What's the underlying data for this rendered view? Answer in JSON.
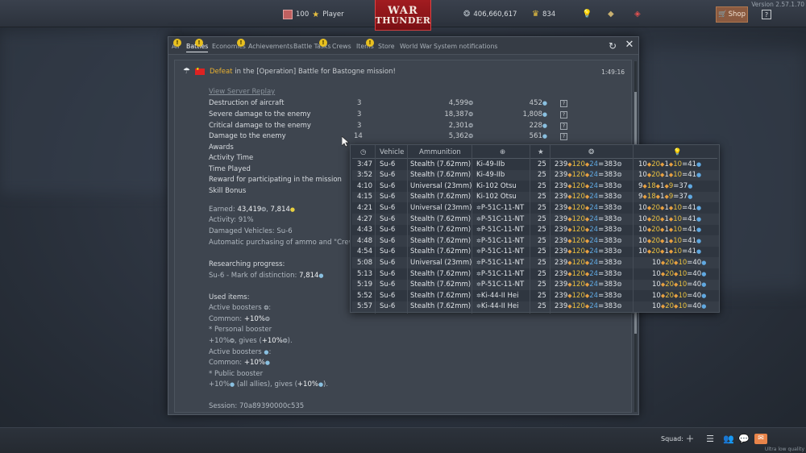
{
  "version": "Version 2.57.1.70",
  "topbar": {
    "player_level": "100",
    "player_name": "Player",
    "logo_line1": "WAR",
    "logo_line2": "THUNDER",
    "silver_lions": "406,660,617",
    "golden_eagles": "834",
    "shop_label": "Shop",
    "help_label": "?"
  },
  "window": {
    "tabs": [
      {
        "label": "All",
        "badge": "!"
      },
      {
        "label": "Battles",
        "badge": "!",
        "active": true
      },
      {
        "label": "Economics",
        "badge": "!"
      },
      {
        "label": "Achievements"
      },
      {
        "label": "Battle Tasks",
        "badge": "!"
      },
      {
        "label": "Crews"
      },
      {
        "label": "Items",
        "badge": "!"
      },
      {
        "label": "Store"
      },
      {
        "label": "World War"
      },
      {
        "label": "System notifications"
      }
    ],
    "refresh_icon": "↻",
    "close_icon": "✕"
  },
  "message": {
    "defeat_word": "Defeat",
    "title_rest": " in the [Operation] Battle for Bastogne mission!",
    "time": "1:49:16",
    "replay_link": "View Server Replay",
    "stats": [
      {
        "label": "Destruction of aircraft",
        "count": "3",
        "sl": "4,599",
        "rp": "452"
      },
      {
        "label": "Severe damage to the enemy",
        "count": "3",
        "sl": "18,387",
        "rp": "1,808"
      },
      {
        "label": "Critical damage to the enemy",
        "count": "3",
        "sl": "2,301",
        "rp": "228"
      },
      {
        "label": "Damage to the enemy",
        "count": "14",
        "sl": "5,362",
        "rp": "561"
      },
      {
        "label": "Awards"
      },
      {
        "label": "Activity Time"
      },
      {
        "label": "Time Played"
      },
      {
        "label": "Reward for participating in the mission"
      },
      {
        "label": "Skill Bonus"
      }
    ],
    "earned_label": "Earned: ",
    "earned_sl": "43,419",
    "earned_rp": "7,814",
    "activity": "Activity: 91%",
    "damaged_vehicles": "Damaged Vehicles: Su-6",
    "auto_purchase": "Automatic purchasing of ammo and \"Crew R",
    "researching_label": "Researching progress:",
    "research_item": "Su-6 - Mark of distinction: ",
    "research_rp": "7,814",
    "used_items_label": "Used items:",
    "active_boosters_sl": "Active boosters ",
    "common_sl_label": "Common: ",
    "common_sl_val": "+10%",
    "personal_booster": "* Personal booster",
    "personal_gives_a": "+10%",
    "personal_gives_b": ", gives (",
    "personal_gives_c": "+10%",
    "personal_gives_d": ").",
    "active_boosters_rp": "Active boosters ",
    "common_rp_label": "Common: ",
    "common_rp_val": "+10%",
    "public_booster": "* Public booster",
    "public_gives_a": "+10%",
    "public_gives_b": " (all allies), gives (",
    "public_gives_c": "+10%",
    "public_gives_d": ").",
    "session": "Session: 70a89390000c535"
  },
  "tooltip": {
    "headers": {
      "time_icon": "clock-icon",
      "vehicle": "Vehicle",
      "ammunition": "Ammunition",
      "target_icon": "crosshair-icon",
      "rank_icon": "star-icon",
      "sl_icon": "silver-lions-icon",
      "rp_icon": "research-points-icon"
    },
    "rows": [
      {
        "time": "3:47",
        "vehicle": "Su-6",
        "ammo": "Stealth (7.62mm)",
        "target": "Ki-49-IIb",
        "rank": "25",
        "sl_a": "239",
        "sl_b": "120",
        "sl_c": "24",
        "sl_t": "=383",
        "rp_a": "10",
        "rp_b": "20",
        "rp_c": "1",
        "rp_d": "10",
        "rp_t": "=41"
      },
      {
        "time": "3:52",
        "vehicle": "Su-6",
        "ammo": "Stealth (7.62mm)",
        "target": "Ki-49-IIb",
        "rank": "25",
        "sl_a": "239",
        "sl_b": "120",
        "sl_c": "24",
        "sl_t": "=383",
        "rp_a": "10",
        "rp_b": "20",
        "rp_c": "1",
        "rp_d": "10",
        "rp_t": "=41"
      },
      {
        "time": "4:10",
        "vehicle": "Su-6",
        "ammo": "Universal (23mm)",
        "target": "Ki-102 Otsu",
        "rank": "25",
        "sl_a": "239",
        "sl_b": "120",
        "sl_c": "24",
        "sl_t": "=383",
        "rp_a": "9",
        "rp_b": "18",
        "rp_c": "1",
        "rp_d": "9",
        "rp_t": "=37"
      },
      {
        "time": "4:15",
        "vehicle": "Su-6",
        "ammo": "Stealth (7.62mm)",
        "target": "Ki-102 Otsu",
        "rank": "25",
        "sl_a": "239",
        "sl_b": "120",
        "sl_c": "24",
        "sl_t": "=383",
        "rp_a": "9",
        "rp_b": "18",
        "rp_c": "1",
        "rp_d": "9",
        "rp_t": "=37"
      },
      {
        "time": "4:21",
        "vehicle": "Su-6",
        "ammo": "Universal (23mm)",
        "target": "P-51C-11-NT",
        "rank": "25",
        "sl_a": "239",
        "sl_b": "120",
        "sl_c": "24",
        "sl_t": "=383",
        "rp_a": "10",
        "rp_b": "20",
        "rp_c": "1",
        "rp_d": "10",
        "rp_t": "=41"
      },
      {
        "time": "4:27",
        "vehicle": "Su-6",
        "ammo": "Stealth (7.62mm)",
        "target": "P-51C-11-NT",
        "rank": "25",
        "sl_a": "239",
        "sl_b": "120",
        "sl_c": "24",
        "sl_t": "=383",
        "rp_a": "10",
        "rp_b": "20",
        "rp_c": "1",
        "rp_d": "10",
        "rp_t": "=41"
      },
      {
        "time": "4:43",
        "vehicle": "Su-6",
        "ammo": "Stealth (7.62mm)",
        "target": "P-51C-11-NT",
        "rank": "25",
        "sl_a": "239",
        "sl_b": "120",
        "sl_c": "24",
        "sl_t": "=383",
        "rp_a": "10",
        "rp_b": "20",
        "rp_c": "1",
        "rp_d": "10",
        "rp_t": "=41"
      },
      {
        "time": "4:48",
        "vehicle": "Su-6",
        "ammo": "Stealth (7.62mm)",
        "target": "P-51C-11-NT",
        "rank": "25",
        "sl_a": "239",
        "sl_b": "120",
        "sl_c": "24",
        "sl_t": "=383",
        "rp_a": "10",
        "rp_b": "20",
        "rp_c": "1",
        "rp_d": "10",
        "rp_t": "=41"
      },
      {
        "time": "4:54",
        "vehicle": "Su-6",
        "ammo": "Stealth (7.62mm)",
        "target": "P-51C-11-NT",
        "rank": "25",
        "sl_a": "239",
        "sl_b": "120",
        "sl_c": "24",
        "sl_t": "=383",
        "rp_a": "10",
        "rp_b": "20",
        "rp_c": "1",
        "rp_d": "10",
        "rp_t": "=41"
      },
      {
        "time": "5:08",
        "vehicle": "Su-6",
        "ammo": "Universal (23mm)",
        "target": "P-51C-11-NT",
        "rank": "25",
        "sl_a": "239",
        "sl_b": "120",
        "sl_c": "24",
        "sl_t": "=383",
        "rp_a": "",
        "rp_b": "10",
        "rp_c": "20",
        "rp_d": "10",
        "rp_t": "=40"
      },
      {
        "time": "5:13",
        "vehicle": "Su-6",
        "ammo": "Stealth (7.62mm)",
        "target": "P-51C-11-NT",
        "rank": "25",
        "sl_a": "239",
        "sl_b": "120",
        "sl_c": "24",
        "sl_t": "=383",
        "rp_a": "",
        "rp_b": "10",
        "rp_c": "20",
        "rp_d": "10",
        "rp_t": "=40"
      },
      {
        "time": "5:19",
        "vehicle": "Su-6",
        "ammo": "Stealth (7.62mm)",
        "target": "P-51C-11-NT",
        "rank": "25",
        "sl_a": "239",
        "sl_b": "120",
        "sl_c": "24",
        "sl_t": "=383",
        "rp_a": "",
        "rp_b": "10",
        "rp_c": "20",
        "rp_d": "10",
        "rp_t": "=40"
      },
      {
        "time": "5:52",
        "vehicle": "Su-6",
        "ammo": "Stealth (7.62mm)",
        "target": "Ki-44-II Hei",
        "rank": "25",
        "sl_a": "239",
        "sl_b": "120",
        "sl_c": "24",
        "sl_t": "=383",
        "rp_a": "",
        "rp_b": "10",
        "rp_c": "20",
        "rp_d": "10",
        "rp_t": "=40"
      },
      {
        "time": "5:57",
        "vehicle": "Su-6",
        "ammo": "Stealth (7.62mm)",
        "target": "Ki-44-II Hei",
        "rank": "25",
        "sl_a": "239",
        "sl_b": "120",
        "sl_c": "24",
        "sl_t": "=383",
        "rp_a": "",
        "rp_b": "10",
        "rp_c": "20",
        "rp_d": "10",
        "rp_t": "=40"
      }
    ]
  },
  "bottombar": {
    "squad_label": "Squad:",
    "quality": "Ultra low quality"
  },
  "colors": {
    "defeat": "#e8b030",
    "logo_red": "#a21c20",
    "booster_orange": "#e8a040",
    "rp_blue": "#60a8e0",
    "gold": "#e8c040"
  }
}
